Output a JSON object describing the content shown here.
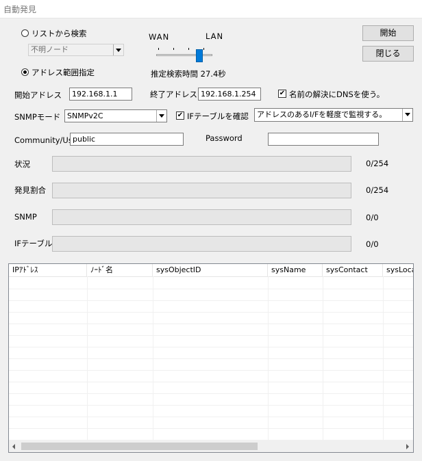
{
  "window": {
    "title": "自動発見"
  },
  "search_mode": {
    "list_option_label": "リストから検索",
    "list_select_value": "不明ノード",
    "range_option_label": "アドレス範囲指定",
    "selected": "range"
  },
  "slider": {
    "left_label": "WAN",
    "right_label": "LAN",
    "estimate_text": "推定検索時間 27.4秒"
  },
  "buttons": {
    "start": "開始",
    "close": "閉じる"
  },
  "address": {
    "start_label": "開始アドレス",
    "start_value": "192.168.1.1",
    "end_label": "終了アドレス",
    "end_value": "192.168.1.254",
    "dns_label": "名前の解決にDNSを使う。",
    "dns_checked": true
  },
  "snmp": {
    "mode_label": "SNMPモード",
    "mode_value": "SNMPv2C",
    "if_table_label": "IFテーブルを確認",
    "if_table_checked": true,
    "monitor_value": "アドレスのあるI/Fを軽度で監視する。"
  },
  "credentials": {
    "community_label": "Community/User",
    "community_value": "public",
    "password_label": "Password",
    "password_value": ""
  },
  "progress": [
    {
      "label": "状況",
      "count": "0/254"
    },
    {
      "label": "発見割合",
      "count": "0/254"
    },
    {
      "label": "SNMP",
      "count": "0/0"
    },
    {
      "label": "IFテーブル",
      "count": "0/0"
    }
  ],
  "table": {
    "columns": [
      "IPｱﾄﾞﾚｽ",
      "ﾉｰﾄﾞ名",
      "sysObjectID",
      "sysName",
      "sysContact",
      "sysLocation"
    ],
    "rows": []
  }
}
